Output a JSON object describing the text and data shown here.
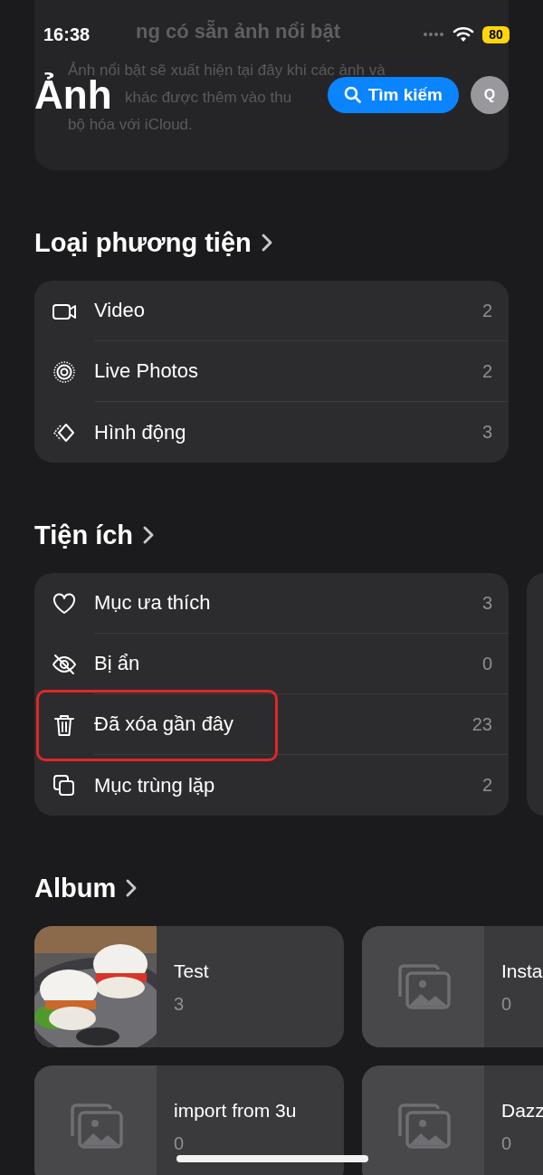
{
  "status_bar": {
    "time": "16:38",
    "battery": "80"
  },
  "featured_card": {
    "title": "ng có sẵn ảnh nổi bật",
    "lines": [
      "Ảnh nổi bật sẽ xuất hiện tại đây khi các ảnh và",
      "khác được thêm vào thu",
      "bộ hóa với iCloud."
    ]
  },
  "header": {
    "title": "Ảnh",
    "search_button": "Tìm kiếm",
    "avatar": "Q"
  },
  "sections": [
    {
      "title": "Loại phương tiện",
      "peek": false,
      "items": [
        {
          "kind": "video",
          "label": "Video",
          "count": "2",
          "highlighted": false
        },
        {
          "kind": "live",
          "label": "Live Photos",
          "count": "2",
          "highlighted": false
        },
        {
          "kind": "animated",
          "label": "Hình động",
          "count": "3",
          "highlighted": false
        }
      ]
    },
    {
      "title": "Tiện ích",
      "peek": true,
      "items": [
        {
          "kind": "favorite",
          "label": "Mục ưa thích",
          "count": "3",
          "highlighted": false
        },
        {
          "kind": "hidden",
          "label": "Bị ẩn",
          "count": "0",
          "highlighted": false
        },
        {
          "kind": "deleted",
          "label": "Đã xóa gần đây",
          "count": "23",
          "highlighted": true
        },
        {
          "kind": "duplicate",
          "label": "Mục trùng lặp",
          "count": "2",
          "highlighted": false
        }
      ]
    }
  ],
  "album": {
    "title": "Album",
    "albums": [
      {
        "kind": "picture",
        "name": "Test",
        "count": "3"
      },
      {
        "kind": "empty",
        "name": "Insta",
        "count": "0"
      },
      {
        "kind": "empty",
        "name": "import from 3u",
        "count": "0"
      },
      {
        "kind": "empty",
        "name": "Dazz",
        "count": "0"
      }
    ]
  }
}
